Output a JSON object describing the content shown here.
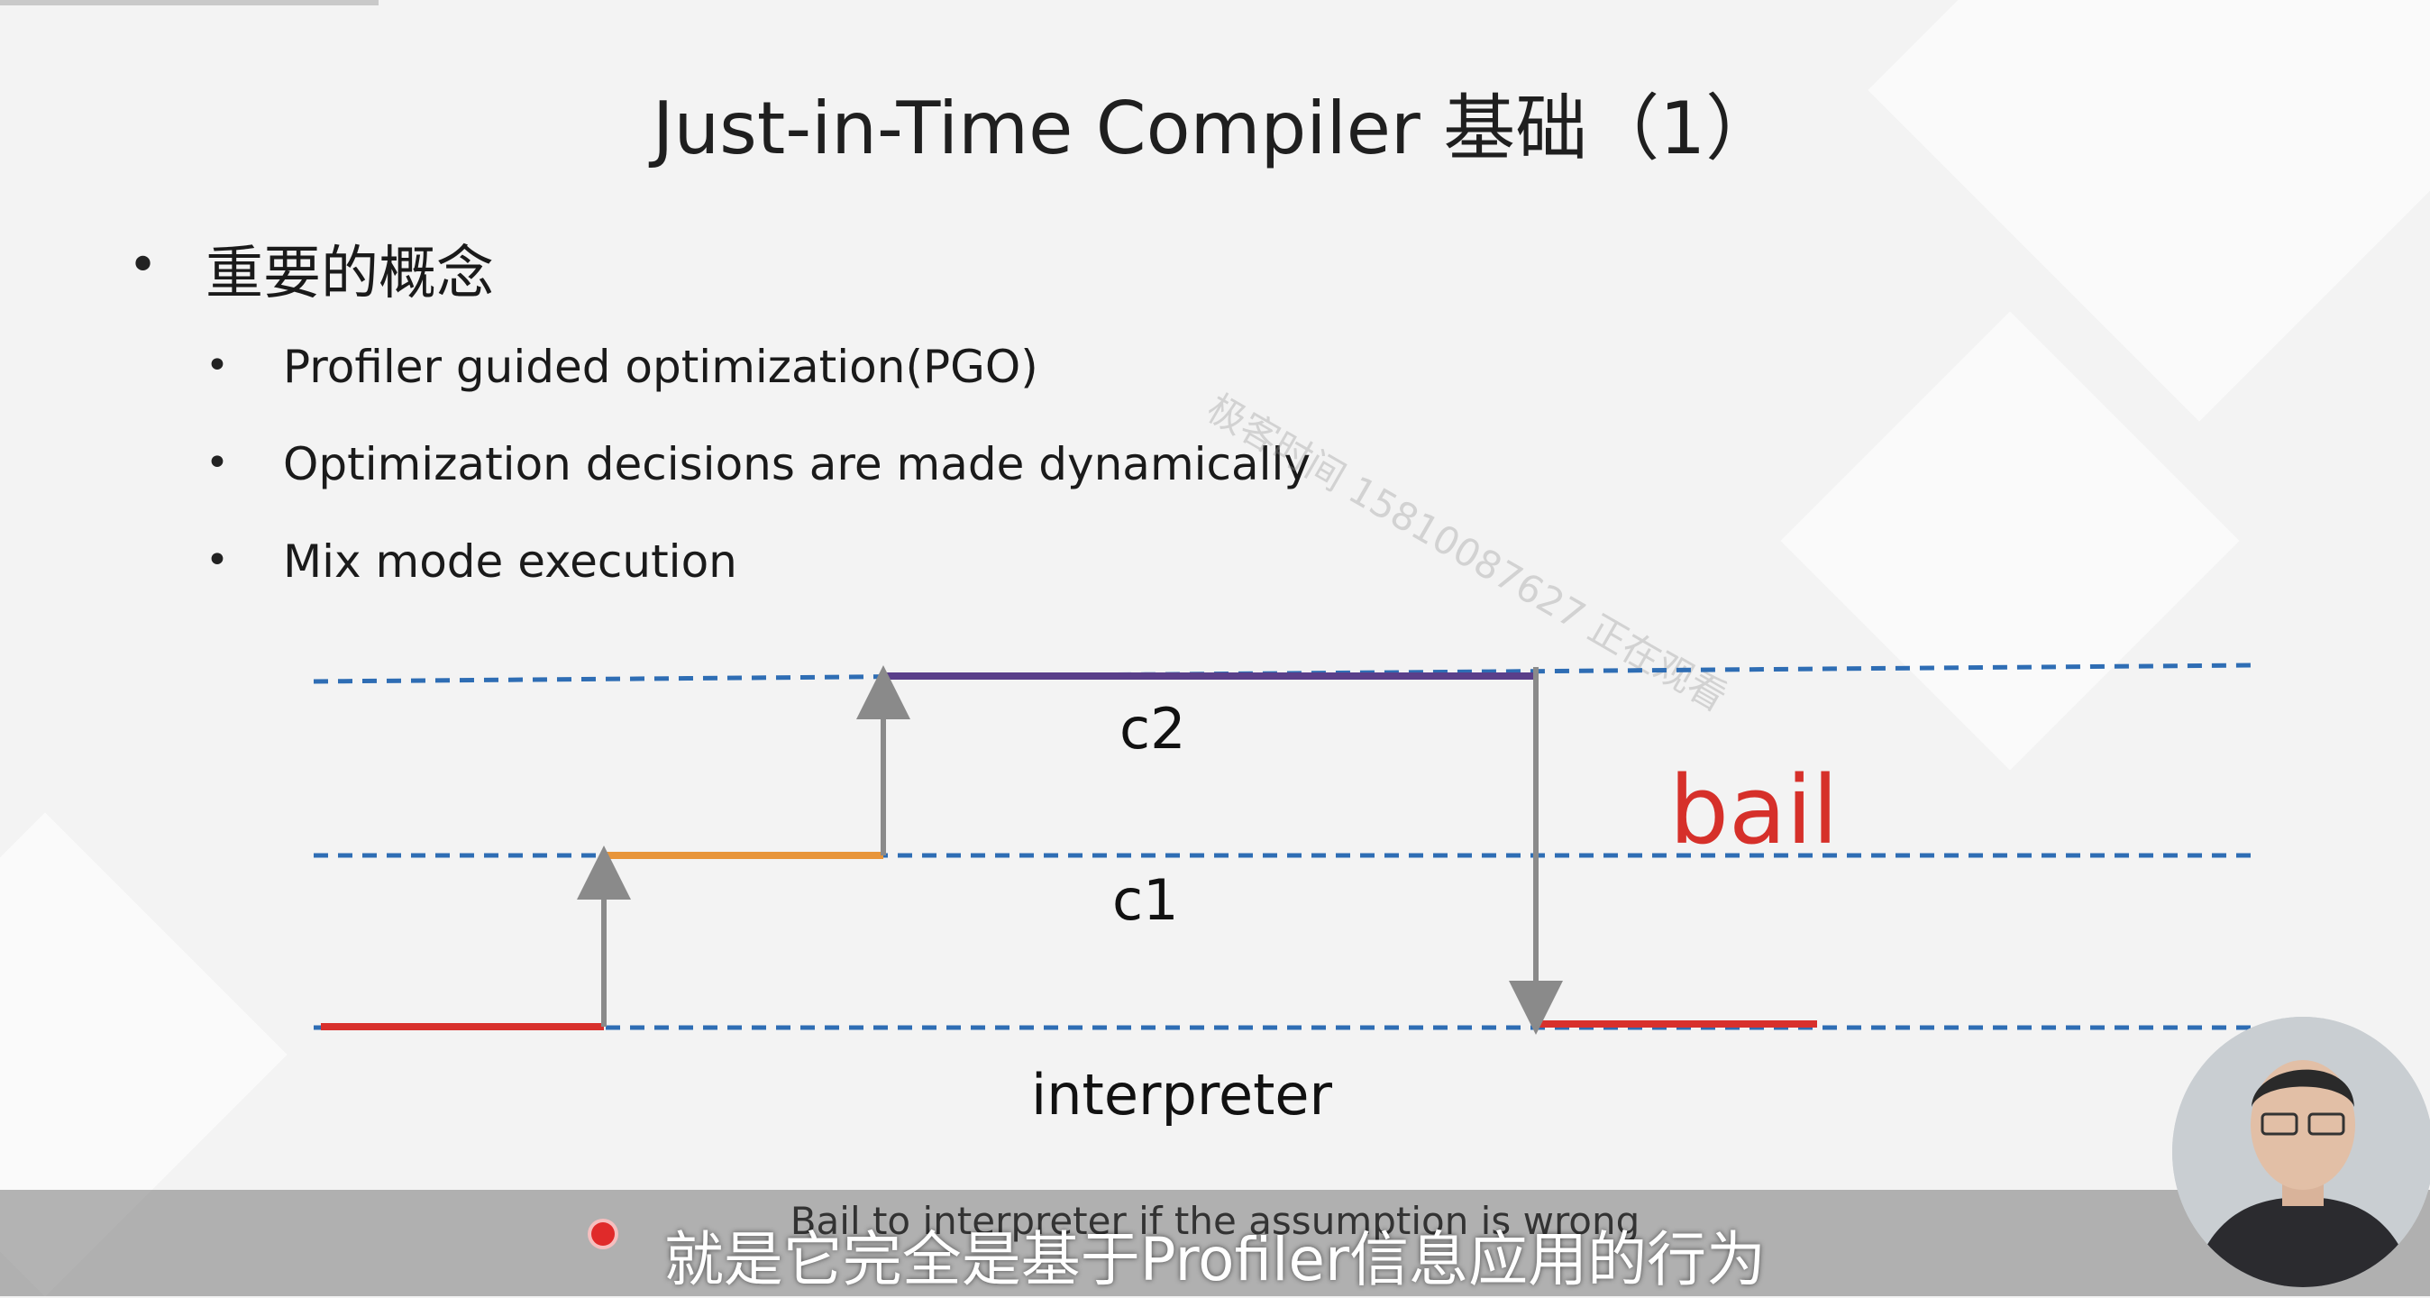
{
  "slide": {
    "title": "Just-in-Time Compiler 基础（1）",
    "bullet_main": "重要的概念",
    "sub_bullets": [
      "Profiler guided optimization(PGO)",
      "Optimization decisions are made dynamically",
      "Mix mode execution"
    ],
    "bullet_symbol": "•"
  },
  "watermark": "极客时间 15810087627 正在观看",
  "diagram": {
    "levels": [
      "c2",
      "c1",
      "interpreter"
    ],
    "bail_label": "bail",
    "caption": "Bail to interpreter if the assumption is wrong"
  },
  "subtitle": {
    "text": "就是它完全是基于Profiler信息应用的行为"
  },
  "colors": {
    "guide_line": "#2e6db4",
    "interpreter_segment": "#d8302c",
    "c1_segment": "#e8953a",
    "c2_segment": "#5a3f8a",
    "arrow": "#8a8a8a",
    "bail_text": "#d6302a"
  },
  "icons": {
    "recording": "record-dot-icon",
    "presenter": "webcam-presenter"
  }
}
